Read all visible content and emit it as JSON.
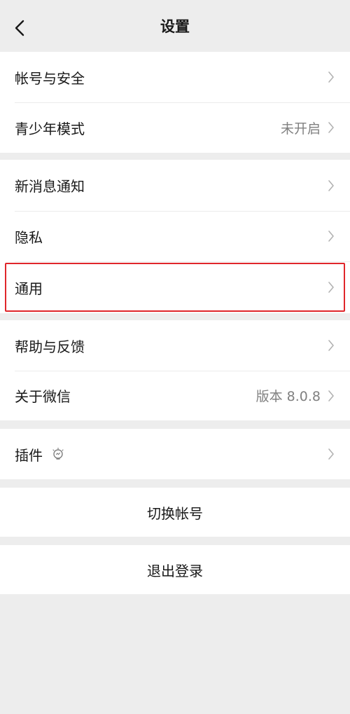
{
  "nav": {
    "title": "设置"
  },
  "group1": [
    {
      "label": "帐号与安全",
      "value": ""
    },
    {
      "label": "青少年模式",
      "value": "未开启"
    }
  ],
  "group2": [
    {
      "label": "新消息通知",
      "value": ""
    },
    {
      "label": "隐私",
      "value": ""
    },
    {
      "label": "通用",
      "value": ""
    }
  ],
  "group3": [
    {
      "label": "帮助与反馈",
      "value": ""
    },
    {
      "label": "关于微信",
      "value": "版本 8.0.8"
    }
  ],
  "group4": [
    {
      "label": "插件",
      "value": ""
    }
  ],
  "actions": {
    "switch_account": "切换帐号",
    "logout": "退出登录"
  },
  "colors": {
    "background": "#ededed",
    "highlight": "#e0262b",
    "secondary_text": "#808080"
  },
  "icons": {
    "back": "chevron-left-icon",
    "row": "chevron-right-icon",
    "plugin": "lightbulb-icon"
  }
}
